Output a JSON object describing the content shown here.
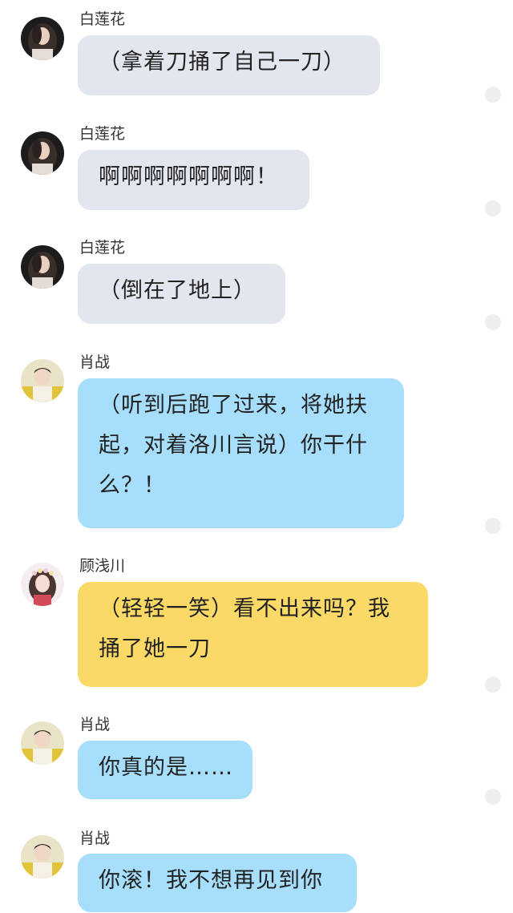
{
  "messages": [
    {
      "sender": "白莲花",
      "text": "（拿着刀捅了自己一刀）",
      "bubble_color": "#e2e6ee",
      "avatar": "avatar-bailianhua"
    },
    {
      "sender": "白莲花",
      "text": "啊啊啊啊啊啊啊！",
      "bubble_color": "#e2e6ee",
      "avatar": "avatar-bailianhua"
    },
    {
      "sender": "白莲花",
      "text": "（倒在了地上）",
      "bubble_color": "#e2e6ee",
      "avatar": "avatar-bailianhua"
    },
    {
      "sender": "肖战",
      "text": "（听到后跑了过来，将她扶起，对着洛川言说）你干什么？！",
      "bubble_color": "#a6defb",
      "avatar": "avatar-xiaozhan"
    },
    {
      "sender": "顾浅川",
      "text": "（轻轻一笑）看不出来吗？我捅了她一刀",
      "bubble_color": "#fbd966",
      "avatar": "avatar-guqianchuan"
    },
    {
      "sender": "肖战",
      "text": "你真的是……",
      "bubble_color": "#a6defb",
      "avatar": "avatar-xiaozhan"
    },
    {
      "sender": "肖战",
      "text": "你滚！我不想再见到你",
      "bubble_color": "#a6defb",
      "avatar": "avatar-xiaozhan"
    }
  ]
}
